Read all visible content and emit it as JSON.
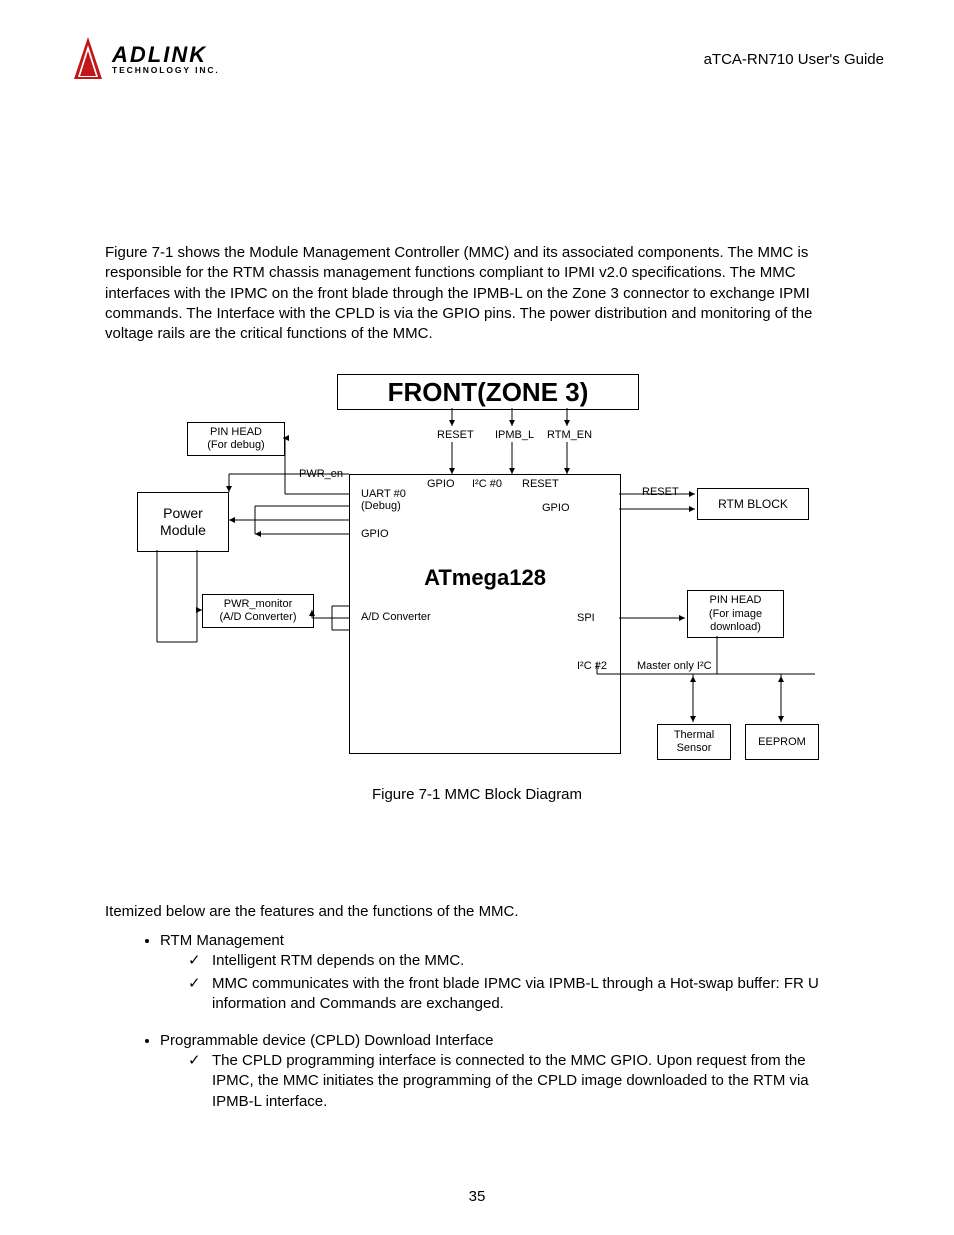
{
  "header": {
    "logo_main": "ADLINK",
    "logo_sub": "TECHNOLOGY INC.",
    "doc_title": "aTCA-RN710 User's Guide"
  },
  "intro_paragraph": "Figure 7-1 shows the Module Management Controller (MMC) and its associated components. The MMC is responsible for the RTM chassis management functions compliant to IPMI v2.0 specifications. The MMC interfaces with the IPMC on the front blade through the IPMB-L on the Zone 3 connector to exchange IPMI commands.  The Interface with the CPLD is via the GPIO pins. The power distribution and monitoring of the voltage rails are the critical functions of the MMC.",
  "diagram": {
    "title": "FRONT(ZONE 3)",
    "chip": "ATmega128",
    "blocks": {
      "pinhead_debug_l1": "PIN HEAD",
      "pinhead_debug_l2": "(For debug)",
      "power_module_l1": "Power",
      "power_module_l2": "Module",
      "pwr_monitor_l1": "PWR_monitor",
      "pwr_monitor_l2": "(A/D Converter)",
      "rtm_block": "RTM BLOCK",
      "pinhead_image_l1": "PIN HEAD",
      "pinhead_image_l2": "(For image",
      "pinhead_image_l3": "download)",
      "thermal_l1": "Thermal",
      "thermal_l2": "Sensor",
      "eeprom": "EEPROM"
    },
    "labels": {
      "reset_top": "RESET",
      "ipmb_l": "IPMB_L",
      "rtm_en": "RTM_EN",
      "pwr_en": "PWR_en",
      "gpio1": "GPIO",
      "i2c0": "I²C #0",
      "reset_mid": "RESET",
      "reset_right": "RESET",
      "uart0_l1": "UART #0",
      "uart0_l2": "(Debug)",
      "gpio2": "GPIO",
      "gpio3": "GPIO",
      "ad_conv": "A/D Converter",
      "spi": "SPI",
      "master_i2c": "Master only I²C",
      "i2c2": "I²C #2"
    }
  },
  "figure_caption": "Figure 7-1 MMC Block Diagram",
  "features_intro": "Itemized below are the features and the functions of the MMC.",
  "features": [
    {
      "title": "RTM Management",
      "items": [
        "Intelligent RTM depends on the MMC.",
        "MMC communicates with the front blade IPMC via IPMB-L through a Hot-swap buffer:  FR U information and Commands are exchanged."
      ]
    },
    {
      "title": "Programmable device (CPLD) Download Interface",
      "items": [
        "The CPLD programming interface is connected to the MMC GPIO. Upon request from the IPMC, the MMC initiates the programming of the CPLD image downloaded to the RTM via IPMB-L interface."
      ]
    }
  ],
  "page_number": "35"
}
